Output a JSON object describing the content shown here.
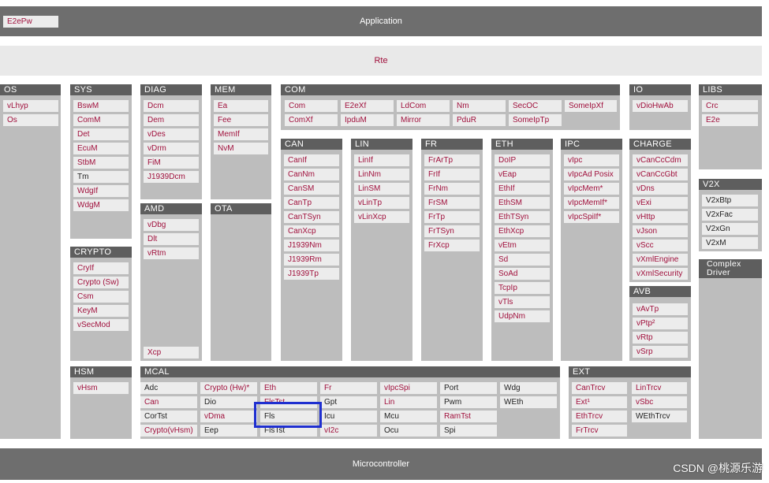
{
  "application": {
    "label": "Application",
    "e2epw": "E2ePw"
  },
  "rte": "Rte",
  "microcontroller": "Microcontroller",
  "watermark": "CSDN @桃源乐游",
  "colors": {
    "module_text": "#a0103c",
    "header": "#5e5e5e",
    "group": "#bdbdbd",
    "module_bg": "#ececec",
    "highlight": "#1f2fd0"
  },
  "groups": {
    "os": {
      "title": "OS",
      "items": [
        "vLhyp",
        "Os"
      ]
    },
    "sys": {
      "title": "SYS",
      "items": [
        "BswM",
        "ComM",
        "Det",
        "EcuM",
        "StbM",
        "Tm",
        "WdgIf",
        "WdgM"
      ]
    },
    "crypto": {
      "title": "CRYPTO",
      "items": [
        "CryIf",
        "Crypto (Sw)",
        "Csm",
        "KeyM",
        "vSecMod"
      ]
    },
    "hsm": {
      "title": "HSM",
      "items": [
        "vHsm"
      ]
    },
    "diag": {
      "title": "DIAG",
      "items": [
        "Dcm",
        "Dem",
        "vDes",
        "vDrm",
        "FiM",
        "J1939Dcm"
      ]
    },
    "amd": {
      "title": "AMD",
      "items": [
        "vDbg",
        "Dlt",
        "vRtm"
      ]
    },
    "xcp": "Xcp",
    "mem": {
      "title": "MEM",
      "items": [
        "Ea",
        "Fee",
        "MemIf",
        "NvM"
      ]
    },
    "ota": {
      "title": "OTA"
    },
    "com": {
      "title": "COM",
      "items": [
        "Com",
        "E2eXf",
        "LdCom",
        "Nm",
        "SecOC",
        "SomeIpXf",
        "ComXf",
        "IpduM",
        "Mirror",
        "PduR",
        "SomeIpTp"
      ]
    },
    "can": {
      "title": "CAN",
      "items": [
        "CanIf",
        "CanNm",
        "CanSM",
        "CanTp",
        "CanTSyn",
        "CanXcp",
        "J1939Nm",
        "J1939Rm",
        "J1939Tp"
      ]
    },
    "lin": {
      "title": "LIN",
      "items": [
        "LinIf",
        "LinNm",
        "LinSM",
        "vLinTp",
        "vLinXcp"
      ]
    },
    "fr": {
      "title": "FR",
      "items": [
        "FrArTp",
        "FrIf",
        "FrNm",
        "FrSM",
        "FrTp",
        "FrTSyn",
        "FrXcp"
      ]
    },
    "eth": {
      "title": "ETH",
      "items": [
        "DoIP",
        "vEap",
        "EthIf",
        "EthSM",
        "EthTSyn",
        "EthXcp",
        "vEtm",
        "Sd",
        "SoAd",
        "TcpIp",
        "vTls",
        "UdpNm"
      ]
    },
    "ipc": {
      "title": "IPC",
      "items": [
        "vIpc",
        "vIpcAd Posix",
        "vIpcMem*",
        "vIpcMemIf*",
        "vIpcSpiIf*"
      ]
    },
    "io": {
      "title": "IO",
      "items": [
        "vDioHwAb"
      ]
    },
    "charge": {
      "title": "CHARGE",
      "items": [
        "vCanCcCdm",
        "vCanCcGbt",
        "vDns",
        "vExi",
        "vHttp",
        "vJson",
        "vScc",
        "vXmlEngine",
        "vXmlSecurity"
      ]
    },
    "avb": {
      "title": "AVB",
      "items": [
        "vAvTp",
        "vPtp²",
        "vRtp",
        "vSrp"
      ]
    },
    "libs": {
      "title": "LIBS",
      "items": [
        "Crc",
        "E2e"
      ]
    },
    "v2x": {
      "title": "V2X",
      "items": [
        "V2xBtp",
        "V2xFac",
        "V2xGn",
        "V2xM"
      ]
    },
    "cdd": {
      "title": "Complex Driver"
    },
    "mcal": {
      "title": "MCAL",
      "items": [
        "Adc",
        "Crypto (Hw)*",
        "Eth",
        "Fr",
        "vIpcSpi",
        "Port",
        "Wdg",
        "Can",
        "Dio",
        "FlsTst",
        "Gpt",
        "Lin",
        "Pwm",
        "WEth",
        "CorTst",
        "vDma",
        "Fls",
        "Icu",
        "Mcu",
        "RamTst",
        "Crypto(vHsm)",
        "Eep",
        "FlsTst",
        "vI2c",
        "Ocu",
        "Spi"
      ]
    },
    "ext": {
      "title": "EXT",
      "items": [
        "CanTrcv",
        "LinTrcv",
        "Ext¹",
        "vSbc",
        "EthTrcv",
        "WEthTrcv",
        "FrTrcv"
      ]
    }
  }
}
